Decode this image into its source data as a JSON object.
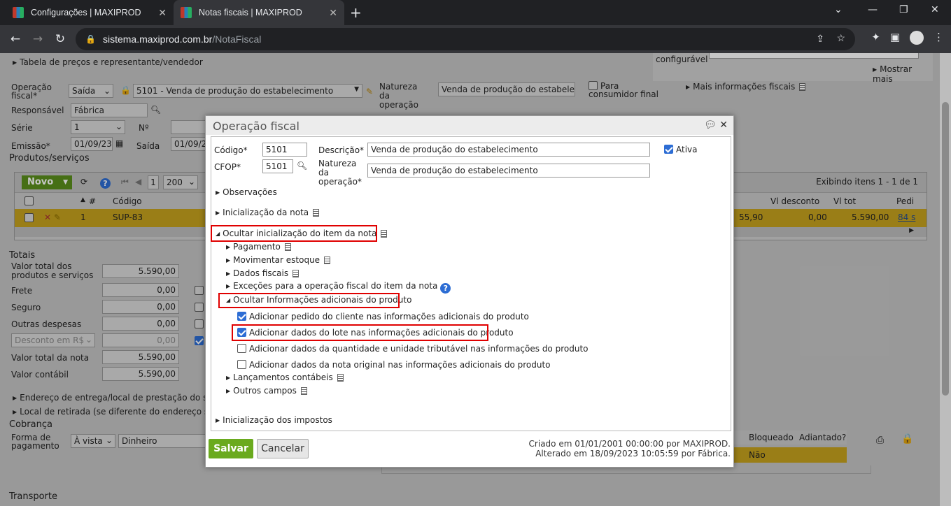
{
  "browser": {
    "tabs": [
      {
        "title": "Configurações | MAXIPROD"
      },
      {
        "title": "Notas fiscais | MAXIPROD"
      }
    ],
    "url_host": "sistema.maxiprod.com.br",
    "url_path": "/NotaFiscal"
  },
  "page": {
    "tabela_precos": "Tabela de preços e representante/vendedor",
    "configuravel": "configurável",
    "mostrar_mais": "Mostrar mais",
    "operacao_fiscal_label": "Operação fiscal*",
    "operacao_tipo": "Saída",
    "operacao_value": "5101 - Venda de produção do estabelecimento",
    "natureza_label": "Natureza da operação",
    "natureza_value": "Venda de produção do estabelecime",
    "consumidor_final": "Para consumidor final",
    "mais_info": "Mais informações fiscais",
    "responsavel_label": "Responsável",
    "responsavel_value": "Fábrica",
    "serie_label": "Série",
    "serie_value": "1",
    "numero_label": "Nº",
    "emissao_label": "Emissão*",
    "emissao_value": "01/09/23",
    "saida_label": "Saída",
    "saida_value": "01/09/23",
    "produtos_title": "Produtos/serviços",
    "grid": {
      "novo": "Novo",
      "page": "1",
      "page_size": "200",
      "exibindo": "Exibindo itens 1 - 1 de 1",
      "headers": [
        "#",
        "Código",
        "Vl desconto",
        "Vl tot",
        "Pedi"
      ],
      "row": {
        "num": "1",
        "codigo": "SUP-83",
        "price": "55,90",
        "desconto": "0,00",
        "total": "5.590,00",
        "pedido": "84 s"
      }
    },
    "totais": {
      "title": "Totais",
      "rows": [
        {
          "label": "Valor total dos produtos e serviços",
          "value": "5.590,00"
        },
        {
          "label": "Frete",
          "value": "0,00"
        },
        {
          "label": "Seguro",
          "value": "0,00"
        },
        {
          "label": "Outras despesas",
          "value": "0,00"
        },
        {
          "label": "Desconto em R$",
          "value": "0,00"
        },
        {
          "label": "Valor total da nota",
          "value": "5.590,00"
        },
        {
          "label": "Valor contábil",
          "value": "5.590,00"
        }
      ]
    },
    "endereco_entrega": "Endereço de entrega/local de prestação do serviç",
    "local_retirada": "Local de retirada (se diferente do endereço sede)",
    "cobranca": "Cobrança",
    "forma_pagamento_label": "Forma de pagamento",
    "forma_pagamento_value": "À vista",
    "meio_pagamento": "Dinheiro",
    "bloqueado": "Bloqueado",
    "adiantado": "Adiantado?",
    "nao": "Não",
    "transporte": "Transporte"
  },
  "modal": {
    "title": "Operação fiscal",
    "codigo_label": "Código*",
    "codigo_value": "5101",
    "descricao_label": "Descrição*",
    "descricao_value": "Venda de produção do estabelecimento",
    "ativa_label": "Ativa",
    "cfop_label": "CFOP*",
    "cfop_value": "5101",
    "natureza_label": "Natureza da operação*",
    "natureza_value": "Venda de produção do estabelecimento",
    "observacoes": "Observações",
    "inicializacao_nota": "Inicialização da nota",
    "ocultar_item": "Ocultar inicialização do item da nota",
    "pagamento": "Pagamento",
    "movimentar_estoque": "Movimentar estoque",
    "dados_fiscais": "Dados fiscais",
    "excecoes": "Exceções para a operação fiscal do item da nota",
    "ocultar_info": "Ocultar Informações adicionais do produto",
    "chk1": "Adicionar pedido do cliente nas informações adicionais do produto",
    "chk2": "Adicionar dados do lote nas informações adicionais do produto",
    "chk3": "Adicionar dados da quantidade e unidade tributável nas informações do produto",
    "chk4": "Adicionar dados da nota original nas informações adicionais do produto",
    "lancamentos": "Lançamentos contábeis",
    "outros_campos": "Outros campos",
    "inicializacao_impostos": "Inicialização dos impostos",
    "salvar": "Salvar",
    "cancelar": "Cancelar",
    "criado": "Criado em 01/01/2001 00:00:00 por MAXIPROD.",
    "alterado": "Alterado em 18/09/2023 10:05:59 por Fábrica."
  }
}
